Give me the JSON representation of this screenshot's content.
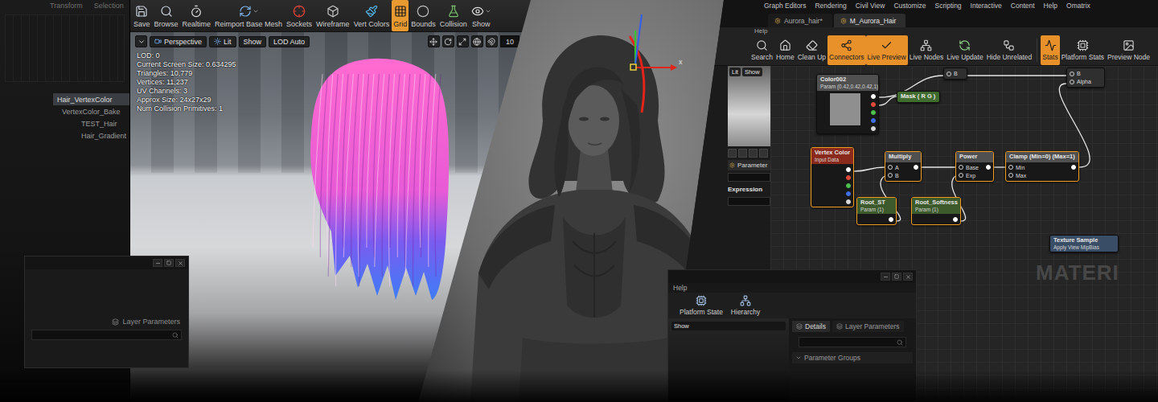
{
  "left_editor": {
    "top_tabs": [
      "Transform",
      "Selection"
    ],
    "outliner": [
      {
        "label": "Hair_VertexColor",
        "selected": true
      },
      {
        "label": "VertexColor_Bake",
        "selected": false
      },
      {
        "label": "TEST_Hair",
        "selected": false
      },
      {
        "label": "Hair_Gradient",
        "selected": false
      }
    ],
    "toolbar": [
      {
        "label": "Save",
        "selected": false,
        "dropdown": false
      },
      {
        "label": "Browse",
        "selected": false,
        "dropdown": false
      },
      {
        "label": "Realtime",
        "selected": false,
        "dropdown": false
      },
      {
        "label": "Reimport Base Mesh",
        "selected": false,
        "dropdown": true
      },
      {
        "label": "Sockets",
        "selected": false,
        "dropdown": false
      },
      {
        "label": "Wireframe",
        "selected": false,
        "dropdown": false
      },
      {
        "label": "Vert Colors",
        "selected": false,
        "dropdown": false
      },
      {
        "label": "Grid",
        "selected": true,
        "dropdown": false
      },
      {
        "label": "Bounds",
        "selected": false,
        "dropdown": false
      },
      {
        "label": "Collision",
        "selected": false,
        "dropdown": false
      },
      {
        "label": "Show",
        "selected": false,
        "dropdown": true
      }
    ],
    "viewport": {
      "buttons": [
        "Perspective",
        "Lit",
        "Show",
        "LOD Auto"
      ],
      "grid_snap": "10",
      "stats": [
        "LOD: 0",
        "Current Screen Size: 0.634295",
        "Triangles: 10,779",
        "Vertices: 11,237",
        "UV Channels: 3",
        "Approx Size: 24x27x29",
        "Num Collision Primitives: 1"
      ]
    },
    "layer_window": {
      "tab": "Layer Parameters"
    }
  },
  "character_view": {
    "gizmo_axis": "x"
  },
  "material_editor": {
    "menu": [
      "Graph Editors",
      "Rendering",
      "Civil View",
      "Customize",
      "Scripting",
      "Interactive",
      "Content",
      "Help",
      "Omatrix"
    ],
    "tabs": [
      {
        "label": "Aurora_hair*",
        "selected": false
      },
      {
        "label": "M_Aurora_Hair",
        "selected": true
      }
    ],
    "help_menu": "Help",
    "toolbar": [
      {
        "label": "Search",
        "selected": false
      },
      {
        "label": "Home",
        "selected": false
      },
      {
        "label": "Clean Up",
        "selected": false
      },
      {
        "label": "Connectors",
        "selected": true
      },
      {
        "label": "Live Preview",
        "selected": true
      },
      {
        "label": "Live Nodes",
        "selected": false
      },
      {
        "label": "Live Update",
        "selected": false
      },
      {
        "label": "Hide Unrelated",
        "selected": false
      },
      {
        "label": "Stats",
        "selected": true
      },
      {
        "label": "Platform Stats",
        "selected": false
      },
      {
        "label": "Preview Node",
        "selected": false
      }
    ],
    "preview": {
      "buttons": [
        "Lit",
        "Show"
      ]
    },
    "palette": {
      "tab": "Parameter",
      "heading": "Expression"
    },
    "nodes": [
      {
        "kind": "color",
        "title": "Color002",
        "subtitle": "Param (0.42,0.42,0.42,1)",
        "color": "#505050",
        "selected": false,
        "inputs": [],
        "outputs": [
          "#ffffff",
          "#e04a3a",
          "#4ec04e",
          "#3f6fe0",
          "#d8d8d8"
        ]
      },
      {
        "kind": "compact",
        "title": "Mask ( R G )",
        "color": "#3f6b2e",
        "selected": false,
        "inputs": [],
        "outputs": []
      },
      {
        "kind": "data",
        "title": "Vertex Color",
        "subtitle": "Input Data",
        "color": "#8a2a1c",
        "selected": true,
        "inputs": [],
        "outputs": [
          "#ffffff",
          "#e04a3a",
          "#4ec04e",
          "#3f6fe0",
          "#d8d8d8"
        ]
      },
      {
        "kind": "math",
        "title": "Multiply",
        "color": "#505050",
        "selected": true,
        "inputs": [
          "A",
          "B"
        ],
        "outputs": [
          "#ffffff"
        ]
      },
      {
        "kind": "math",
        "title": "Power",
        "color": "#505050",
        "selected": true,
        "inputs": [
          "Base",
          "Exp"
        ],
        "outputs": [
          "#ffffff"
        ]
      },
      {
        "kind": "math",
        "title": "Clamp (Min=0) (Max=1)",
        "color": "#505050",
        "selected": true,
        "inputs": [
          "Min",
          "Max"
        ],
        "outputs": [
          "#ffffff"
        ]
      },
      {
        "kind": "param",
        "title": "Root_ST",
        "subtitle": "Param (1)",
        "color": "#3d5a2c",
        "selected": true,
        "inputs": [],
        "outputs": [
          "#ffffff"
        ]
      },
      {
        "kind": "param",
        "title": "Root_Softness",
        "subtitle": "Param (1)",
        "color": "#3d5a2c",
        "selected": true,
        "inputs": [],
        "outputs": [
          "#ffffff"
        ]
      },
      {
        "kind": "stub",
        "color": "#2f2f2f",
        "selected": false,
        "inputs": [
          "B"
        ],
        "outputs": []
      },
      {
        "kind": "stub",
        "color": "#2f2f2f",
        "selected": false,
        "inputs": [
          "B",
          "Alpha"
        ],
        "outputs": []
      },
      {
        "kind": "texture",
        "title": "Texture Sample",
        "subtitle": "Apply View MipBias",
        "color": "#3a4d66",
        "selected": false,
        "inputs": [],
        "outputs": []
      }
    ],
    "watermark": "MATERI"
  },
  "details_window": {
    "menu": "Help",
    "toolbar": [
      "Platform State",
      "Hierarchy"
    ],
    "preview_button": "Show",
    "tabs": [
      {
        "label": "Details",
        "selected": true
      },
      {
        "label": "Layer Parameters",
        "selected": false
      }
    ],
    "group": "Parameter Groups"
  }
}
